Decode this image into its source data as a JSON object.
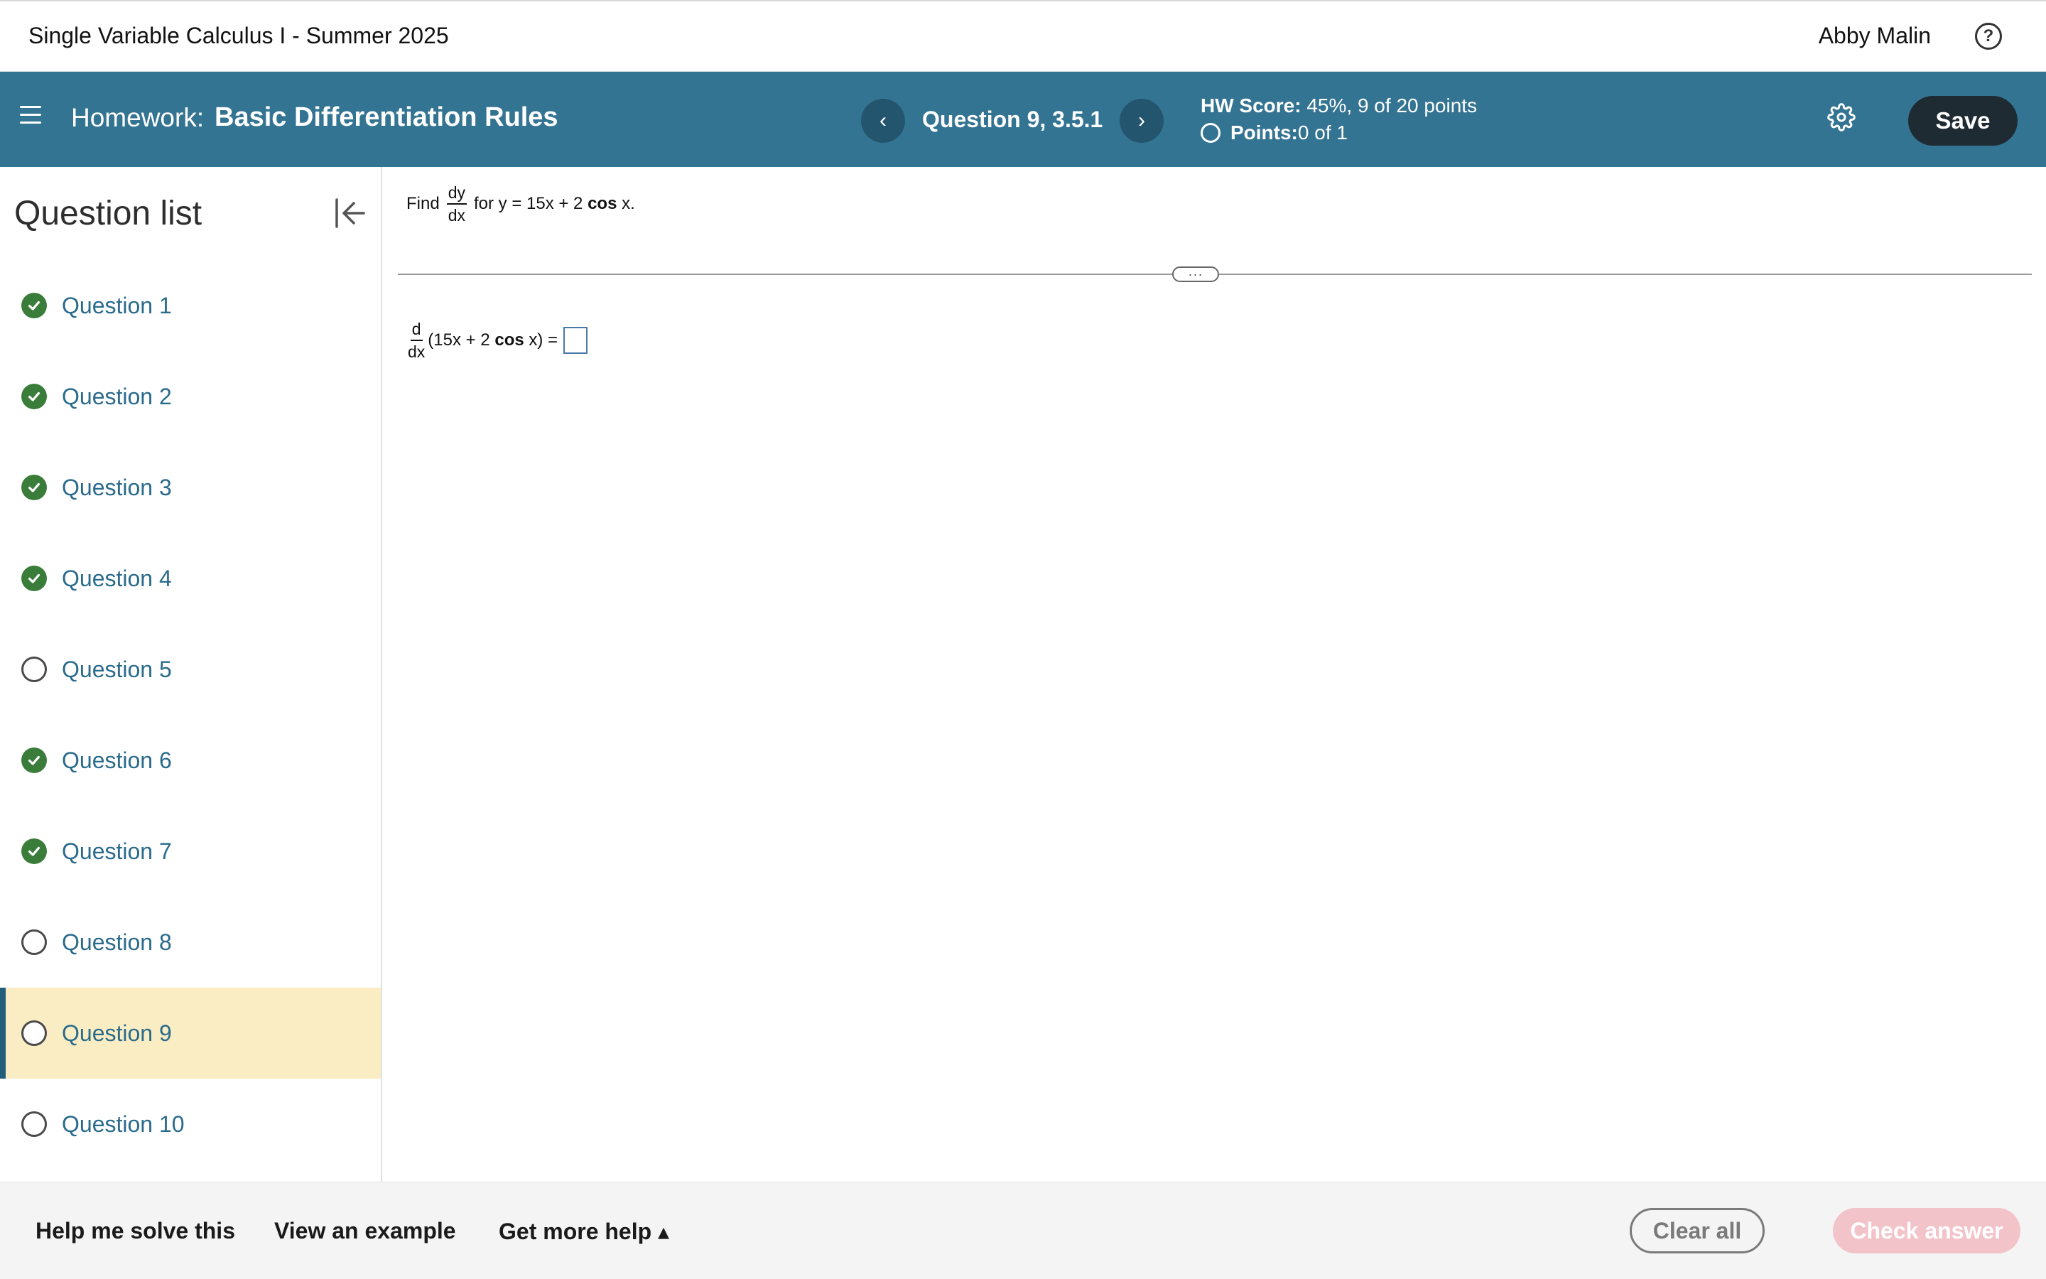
{
  "topbar": {
    "course_title": "Single Variable Calculus I - Summer 2025",
    "user_name": "Abby Malin",
    "help_icon": "question-circle-icon"
  },
  "header": {
    "homework_label": "Homework:",
    "homework_title": "Basic Differentiation Rules",
    "prev_symbol": "‹",
    "next_symbol": "›",
    "question_label": "Question 9, 3.5.1",
    "score_label": "HW Score:",
    "score_value": " 45%, 9 of 20 points",
    "points_label": "Points:",
    "points_value": " 0 of 1",
    "save_label": "Save",
    "colors": {
      "band": "#347493",
      "nav_button": "#24556e",
      "save_button": "#1f2b33"
    }
  },
  "sidebar": {
    "title": "Question list",
    "items": [
      {
        "label": "Question 1",
        "status": "complete"
      },
      {
        "label": "Question 2",
        "status": "complete"
      },
      {
        "label": "Question 3",
        "status": "complete"
      },
      {
        "label": "Question 4",
        "status": "complete"
      },
      {
        "label": "Question 5",
        "status": "incomplete"
      },
      {
        "label": "Question 6",
        "status": "complete"
      },
      {
        "label": "Question 7",
        "status": "complete"
      },
      {
        "label": "Question 8",
        "status": "incomplete"
      },
      {
        "label": "Question 9",
        "status": "incomplete",
        "current": true
      },
      {
        "label": "Question 10",
        "status": "incomplete"
      }
    ],
    "colors": {
      "complete": "#3a7d3a",
      "current_bg": "#faedc4",
      "link": "#2a6b8c"
    }
  },
  "question": {
    "find": "Find",
    "frac_num": "dy",
    "frac_den": "dx",
    "for_y": "for y = 15x + 2",
    "cos": "cos",
    "x_end": " x.",
    "divider_handle": "···",
    "answer_num": "d",
    "answer_den": "dx",
    "answer_expr_a": "(15x + 2",
    "answer_cos": "cos",
    "answer_expr_b": " x) ="
  },
  "bottombar": {
    "help_solve": "Help me solve this",
    "view_example": "View an example",
    "get_more_help": "Get more help ▴",
    "clear_all": "Clear all",
    "check_answer": "Check answer"
  }
}
